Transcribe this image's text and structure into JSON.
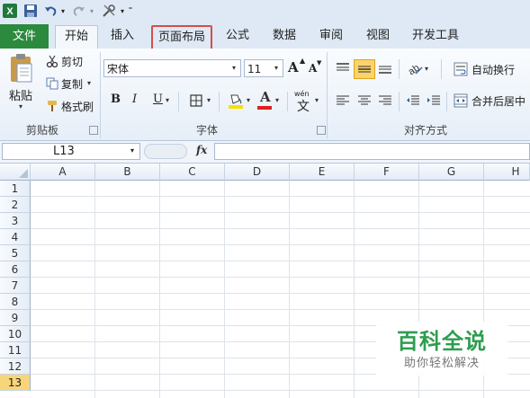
{
  "qat": {
    "icons": [
      "excel-logo-icon",
      "save-icon",
      "undo-icon",
      "dropdown-icon",
      "redo-icon",
      "dropdown-icon",
      "tools-icon",
      "dropdown-icon",
      "customize-icon"
    ]
  },
  "tabs": [
    {
      "label": "文件"
    },
    {
      "label": "开始"
    },
    {
      "label": "插入"
    },
    {
      "label": "页面布局"
    },
    {
      "label": "公式"
    },
    {
      "label": "数据"
    },
    {
      "label": "审阅"
    },
    {
      "label": "视图"
    },
    {
      "label": "开发工具"
    }
  ],
  "clipboard": {
    "paste": "粘贴",
    "cut": "剪切",
    "copy": "复制",
    "format_painter": "格式刷",
    "group": "剪贴板"
  },
  "font": {
    "name": "宋体",
    "size": "11",
    "bold": "B",
    "italic": "I",
    "underline": "U",
    "grow": "A",
    "shrink": "A",
    "color_letter": "A",
    "phonetic_top": "wén",
    "phonetic_char": "文",
    "group": "字体"
  },
  "alignment": {
    "wrap": "自动换行",
    "merge": "合并后居中",
    "group": "对齐方式"
  },
  "formula_bar": {
    "name_box": "L13",
    "fx": "fx",
    "formula": ""
  },
  "grid": {
    "columns": [
      "A",
      "B",
      "C",
      "D",
      "E",
      "F",
      "G",
      "H"
    ],
    "rows": [
      "1",
      "2",
      "3",
      "4",
      "5",
      "6",
      "7",
      "8",
      "9",
      "10",
      "11",
      "12",
      "13"
    ],
    "selected_row": "13"
  },
  "watermark": {
    "title": "百科全说",
    "subtitle": "助你轻松解决"
  },
  "colors": {
    "file_tab": "#2b8a3e",
    "highlight_box": "#d84c4c",
    "selected_row": "#f9d57a",
    "font_color": "#e02020",
    "fill_color": "#f5e200"
  }
}
